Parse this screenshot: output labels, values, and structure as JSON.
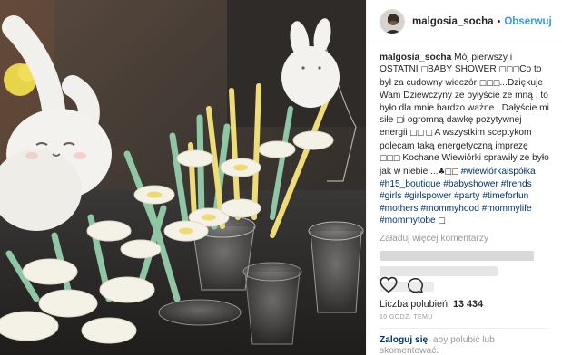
{
  "post": {
    "username": "malgosia_socha",
    "follow_label": "Obserwuj",
    "separator": "•"
  },
  "caption": {
    "user": "malgosia_socha",
    "parts": [
      {
        "t": "text",
        "v": " Mój pierwszy i OSTATNI "
      },
      {
        "t": "emoji",
        "v": "□"
      },
      {
        "t": "text",
        "v": "BABY SHOWER "
      },
      {
        "t": "emoji",
        "v": "□□□"
      },
      {
        "t": "text",
        "v": "Co to był za cudowny wieczór "
      },
      {
        "t": "emoji",
        "v": "□□□"
      },
      {
        "t": "text",
        "v": "...Dziękuje Wam Dziewczyny ze byłyście ze mną , to było dla mnie bardzo ważne . Dałyście mi siłe "
      },
      {
        "t": "emoji",
        "v": "□"
      },
      {
        "t": "text",
        "v": "i ogromną dawkę pozytywnej energii "
      },
      {
        "t": "emoji",
        "v": "□□ □"
      },
      {
        "t": "text",
        "v": " A wszystkim sceptykom polecam taką energetyczną imprezę "
      },
      {
        "t": "emoji",
        "v": "□□□"
      },
      {
        "t": "text",
        "v": " Kochane Wiewiórki sprawiły ze było jak w niebie ..."
      },
      {
        "t": "emoji",
        "v": "♣□□"
      },
      {
        "t": "text",
        "v": " "
      },
      {
        "t": "tag",
        "v": "#wiewiórkaispółka"
      },
      {
        "t": "text",
        "v": " "
      },
      {
        "t": "tag",
        "v": "#h15_boutique"
      },
      {
        "t": "text",
        "v": " "
      },
      {
        "t": "tag",
        "v": "#babyshower"
      },
      {
        "t": "text",
        "v": " "
      },
      {
        "t": "tag",
        "v": "#frends"
      },
      {
        "t": "text",
        "v": " "
      },
      {
        "t": "tag",
        "v": "#girls"
      },
      {
        "t": "text",
        "v": " "
      },
      {
        "t": "tag",
        "v": "#girlspower"
      },
      {
        "t": "text",
        "v": " "
      },
      {
        "t": "tag",
        "v": "#party"
      },
      {
        "t": "text",
        "v": " "
      },
      {
        "t": "tag",
        "v": "#timeforfun"
      },
      {
        "t": "text",
        "v": " "
      },
      {
        "t": "tag",
        "v": "#mothers"
      },
      {
        "t": "text",
        "v": " "
      },
      {
        "t": "tag",
        "v": "#mommyhood"
      },
      {
        "t": "text",
        "v": " "
      },
      {
        "t": "tag",
        "v": "#mommylife"
      },
      {
        "t": "text",
        "v": " "
      },
      {
        "t": "tag",
        "v": "#mommytobe"
      },
      {
        "t": "text",
        "v": " "
      },
      {
        "t": "emoji",
        "v": "□"
      }
    ]
  },
  "load_more_label": "Załaduj więcej komentarzy",
  "likes": {
    "label": "Liczba polubień:",
    "count": "13 434"
  },
  "time_label": "10 GODZ. TEMU",
  "login_prompt": {
    "link": "Zaloguj się",
    "text": ", aby polubić lub skomentować."
  },
  "icons": {
    "like": "heart-outline-icon",
    "comment": "comment-bubble-icon"
  },
  "colors": {
    "link_blue": "#3897f0",
    "hashtag": "#003569",
    "muted": "#999999",
    "text": "#262626"
  }
}
